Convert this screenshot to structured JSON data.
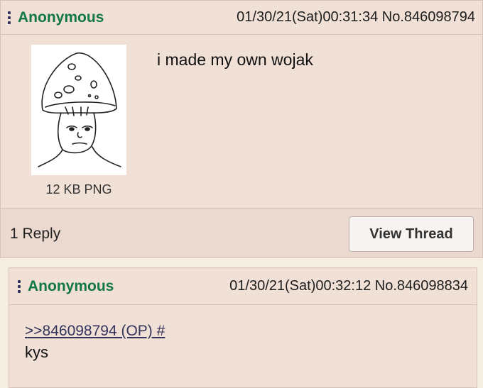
{
  "op_post": {
    "name": "Anonymous",
    "datetime_number": "01/30/21(Sat)00:31:34 No.846098794",
    "file_info": "12 KB PNG",
    "message": "i made my own wojak",
    "reply_count": "1 Reply",
    "view_thread_label": "View Thread"
  },
  "reply_post": {
    "name": "Anonymous",
    "datetime_number": "01/30/21(Sat)00:32:12 No.846098834",
    "quote_link": ">>846098794 (OP) #",
    "message": "kys"
  },
  "colors": {
    "post_background": "#f0e0d6",
    "name": "#117743",
    "link": "#34345c"
  },
  "icons": [
    "menu-dots-icon",
    "mushroom-wojak-thumbnail"
  ]
}
